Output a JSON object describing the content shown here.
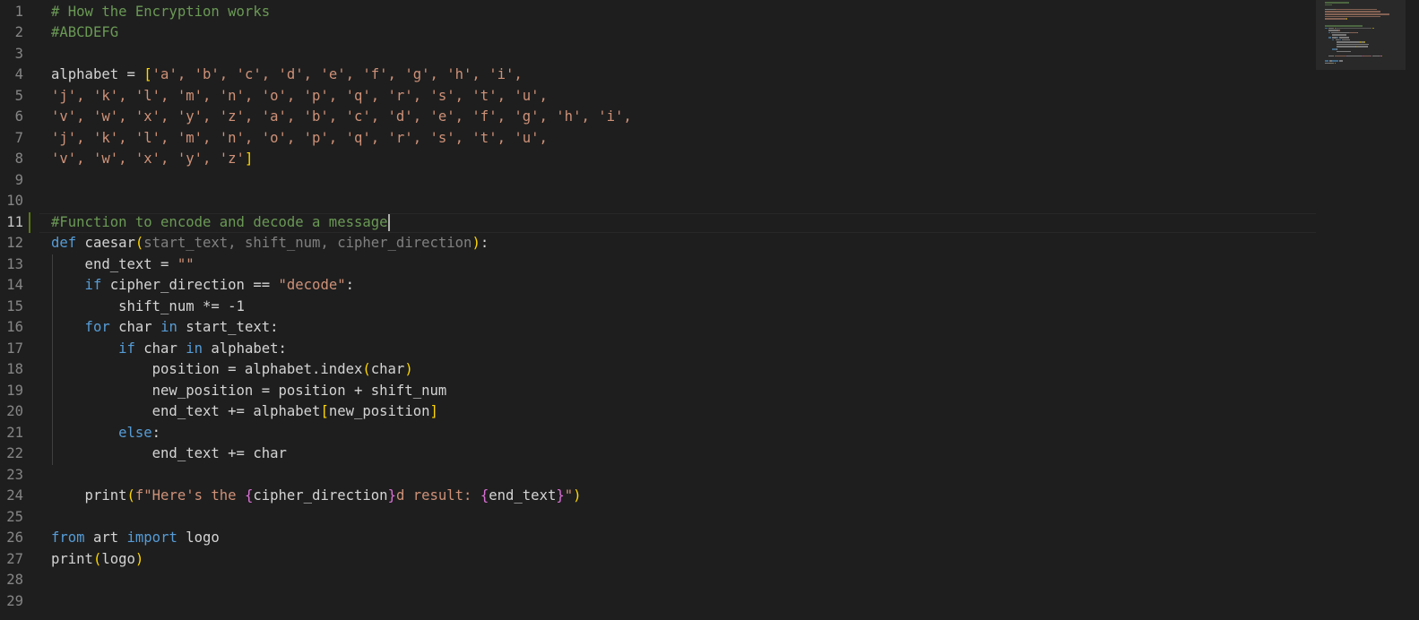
{
  "editor": {
    "active_line": 11,
    "lines": [
      {
        "n": "1",
        "tokens": [
          {
            "t": "# How the Encryption works",
            "c": "c"
          }
        ]
      },
      {
        "n": "2",
        "tokens": [
          {
            "t": "#ABCDEFG",
            "c": "c"
          }
        ]
      },
      {
        "n": "3",
        "tokens": []
      },
      {
        "n": "4",
        "tokens": [
          {
            "t": "alphabet = ",
            "c": "t"
          },
          {
            "t": "[",
            "c": "b1"
          },
          {
            "t": "'a', 'b', 'c', 'd', 'e', 'f', 'g', 'h', 'i',",
            "c": "s"
          }
        ]
      },
      {
        "n": "5",
        "tokens": [
          {
            "t": "'j', 'k', 'l', 'm', 'n', 'o', 'p', 'q', 'r', 's', 't', 'u',",
            "c": "s"
          }
        ]
      },
      {
        "n": "6",
        "tokens": [
          {
            "t": "'v', 'w', 'x', 'y', 'z', 'a', 'b', 'c', 'd', 'e', 'f', 'g', 'h', 'i',",
            "c": "s"
          }
        ]
      },
      {
        "n": "7",
        "tokens": [
          {
            "t": "'j', 'k', 'l', 'm', 'n', 'o', 'p', 'q', 'r', 's', 't', 'u',",
            "c": "s"
          }
        ]
      },
      {
        "n": "8",
        "tokens": [
          {
            "t": "'v', 'w', 'x', 'y', 'z'",
            "c": "s"
          },
          {
            "t": "]",
            "c": "b1"
          }
        ]
      },
      {
        "n": "9",
        "tokens": []
      },
      {
        "n": "10",
        "tokens": []
      },
      {
        "n": "11",
        "tokens": [
          {
            "t": "#Function to encode and decode a message",
            "c": "c"
          }
        ]
      },
      {
        "n": "12",
        "tokens": [
          {
            "t": "def",
            "c": "k"
          },
          {
            "t": " caesar",
            "c": "t"
          },
          {
            "t": "(",
            "c": "b1"
          },
          {
            "t": "start_text, shift_num, cipher_direction",
            "c": "p"
          },
          {
            "t": ")",
            "c": "b1"
          },
          {
            "t": ":",
            "c": "t"
          }
        ]
      },
      {
        "n": "13",
        "tokens": [
          {
            "t": "    end_text = ",
            "c": "t"
          },
          {
            "t": "\"\"",
            "c": "s"
          }
        ]
      },
      {
        "n": "14",
        "tokens": [
          {
            "t": "    if",
            "c": "k"
          },
          {
            "t": " cipher_direction == ",
            "c": "t"
          },
          {
            "t": "\"decode\"",
            "c": "s"
          },
          {
            "t": ":",
            "c": "t"
          }
        ]
      },
      {
        "n": "15",
        "tokens": [
          {
            "t": "        shift_num *= -1",
            "c": "t"
          }
        ]
      },
      {
        "n": "16",
        "tokens": [
          {
            "t": "    for",
            "c": "k"
          },
          {
            "t": " char ",
            "c": "t"
          },
          {
            "t": "in",
            "c": "k"
          },
          {
            "t": " start_text:",
            "c": "t"
          }
        ]
      },
      {
        "n": "17",
        "tokens": [
          {
            "t": "        if",
            "c": "k"
          },
          {
            "t": " char ",
            "c": "t"
          },
          {
            "t": "in",
            "c": "k"
          },
          {
            "t": " alphabet:",
            "c": "t"
          }
        ]
      },
      {
        "n": "18",
        "tokens": [
          {
            "t": "            position = alphabet.index",
            "c": "t"
          },
          {
            "t": "(",
            "c": "b1"
          },
          {
            "t": "char",
            "c": "t"
          },
          {
            "t": ")",
            "c": "b1"
          }
        ]
      },
      {
        "n": "19",
        "tokens": [
          {
            "t": "            new_position = position + shift_num",
            "c": "t"
          }
        ]
      },
      {
        "n": "20",
        "tokens": [
          {
            "t": "            end_text += alphabet",
            "c": "t"
          },
          {
            "t": "[",
            "c": "b1"
          },
          {
            "t": "new_position",
            "c": "t"
          },
          {
            "t": "]",
            "c": "b1"
          }
        ]
      },
      {
        "n": "21",
        "tokens": [
          {
            "t": "        else",
            "c": "k"
          },
          {
            "t": ":",
            "c": "t"
          }
        ]
      },
      {
        "n": "22",
        "tokens": [
          {
            "t": "            end_text += char",
            "c": "t"
          }
        ]
      },
      {
        "n": "23",
        "tokens": []
      },
      {
        "n": "24",
        "tokens": [
          {
            "t": "    print",
            "c": "t"
          },
          {
            "t": "(",
            "c": "b1"
          },
          {
            "t": "f\"Here's the ",
            "c": "s"
          },
          {
            "t": "{",
            "c": "b2"
          },
          {
            "t": "cipher_direction",
            "c": "t"
          },
          {
            "t": "}",
            "c": "b2"
          },
          {
            "t": "d result: ",
            "c": "s"
          },
          {
            "t": "{",
            "c": "b2"
          },
          {
            "t": "end_text",
            "c": "t"
          },
          {
            "t": "}",
            "c": "b2"
          },
          {
            "t": "\"",
            "c": "s"
          },
          {
            "t": ")",
            "c": "b1"
          }
        ]
      },
      {
        "n": "25",
        "tokens": []
      },
      {
        "n": "26",
        "tokens": [
          {
            "t": "from",
            "c": "k"
          },
          {
            "t": " art ",
            "c": "t"
          },
          {
            "t": "import",
            "c": "k"
          },
          {
            "t": " logo",
            "c": "t"
          }
        ]
      },
      {
        "n": "27",
        "tokens": [
          {
            "t": "print",
            "c": "t"
          },
          {
            "t": "(",
            "c": "b1"
          },
          {
            "t": "logo",
            "c": "t"
          },
          {
            "t": ")",
            "c": "b1"
          }
        ]
      },
      {
        "n": "28",
        "tokens": []
      },
      {
        "n": "29",
        "tokens": []
      }
    ]
  },
  "colors": {
    "background": "#1e1e1e",
    "comment": "#6a9955",
    "keyword": "#569cd6",
    "string": "#ce9178",
    "bracket_1": "#ffd700",
    "bracket_2": "#da70d6",
    "parameter": "#808080",
    "line_number": "#858585",
    "modified_indicator": "#587c0c"
  }
}
